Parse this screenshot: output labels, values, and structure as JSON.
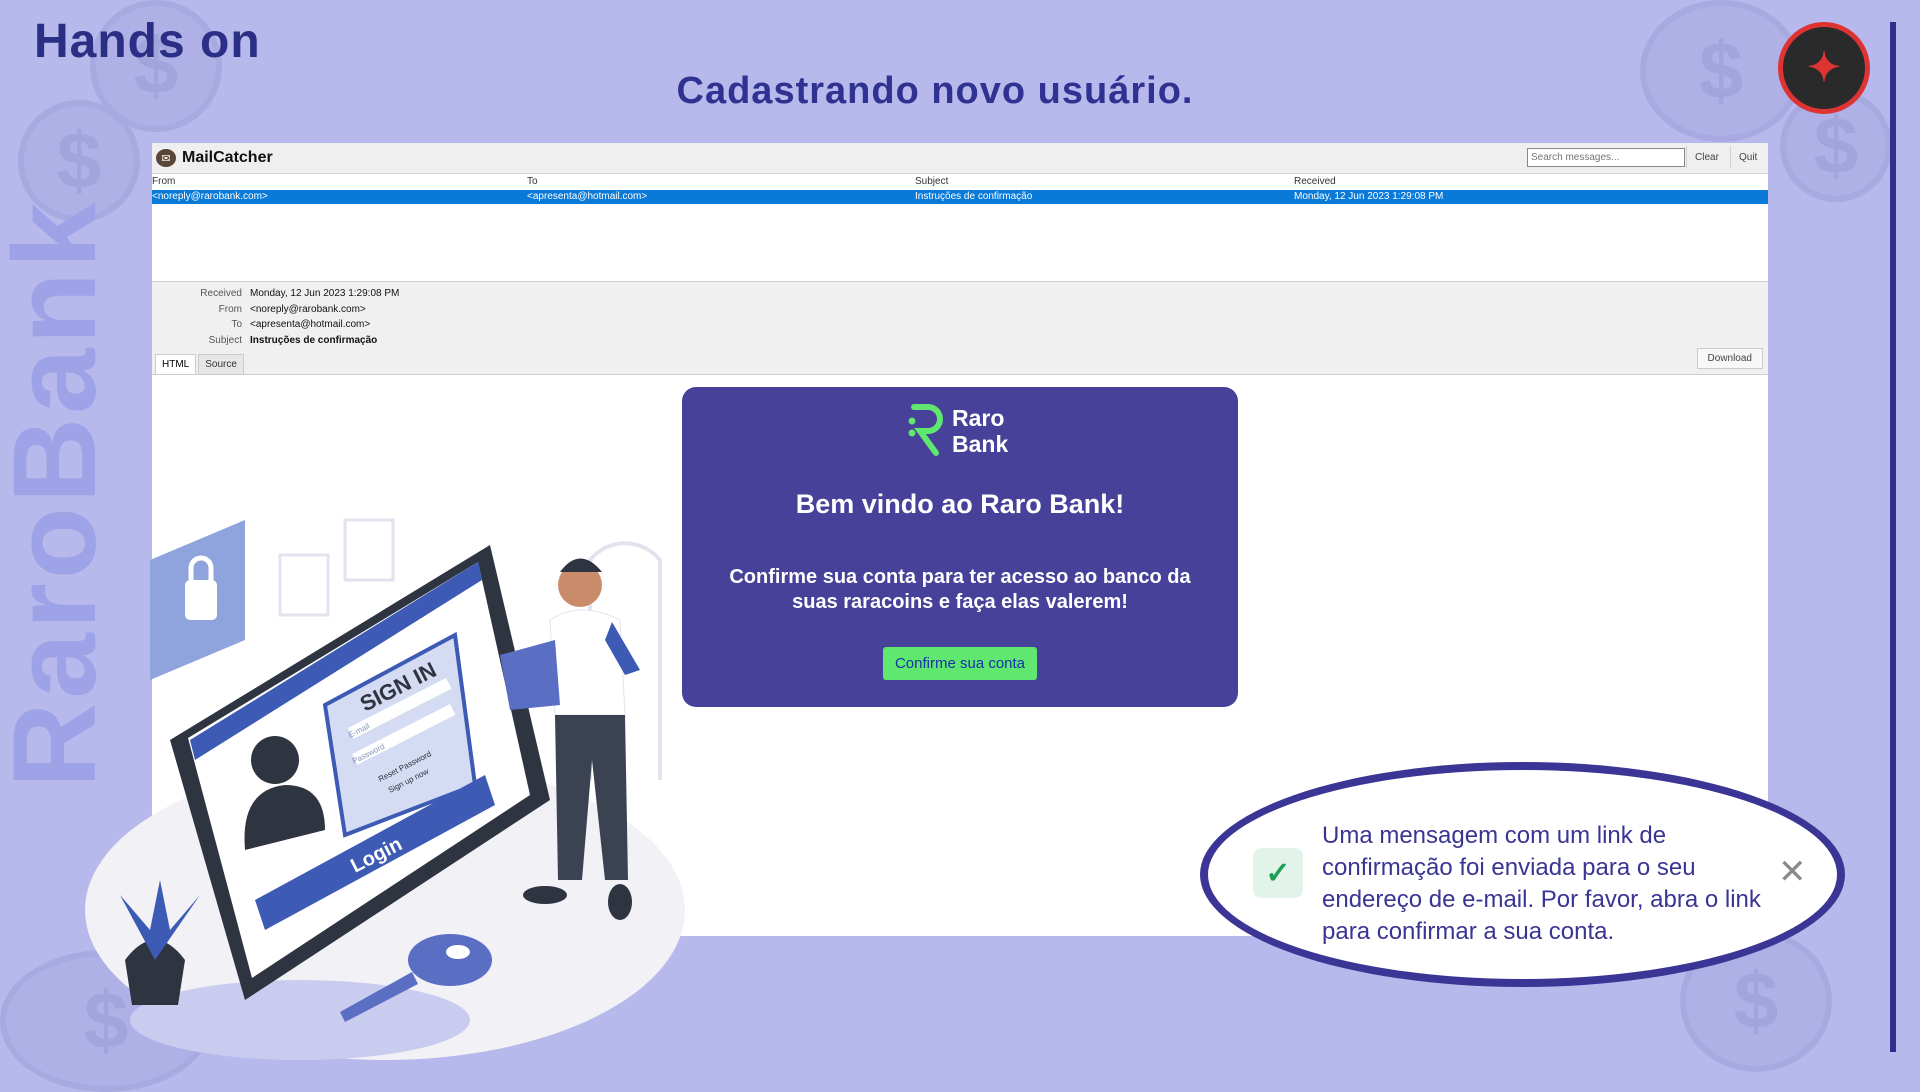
{
  "slide": {
    "title": "Hands on",
    "subtitle": "Cadastrando novo usuário.",
    "vertical_brand": "RaroBank",
    "coin_symbol": "$"
  },
  "mailcatcher": {
    "app_name": "MailCatcher",
    "search_placeholder": "Search messages...",
    "clear_label": "Clear",
    "quit_label": "Quit",
    "columns": [
      "From",
      "To",
      "Subject",
      "Received"
    ],
    "messages": [
      {
        "from": "<noreply@rarobank.com>",
        "to": "<apresenta@hotmail.com>",
        "subject": "Instruções de confirmação",
        "received": "Monday, 12 Jun 2023 1:29:08 PM"
      }
    ],
    "detail": {
      "received_label": "Received",
      "received": "Monday, 12 Jun 2023 1:29:08 PM",
      "from_label": "From",
      "from": "<noreply@rarobank.com>",
      "to_label": "To",
      "to": "<apresenta@hotmail.com>",
      "subject_label": "Subject",
      "subject": "Instruções de confirmação"
    },
    "tabs": [
      "HTML",
      "Source"
    ],
    "download_label": "Download"
  },
  "email": {
    "brand_line1": "Raro",
    "brand_line2": "Bank",
    "heading": "Bem vindo ao Raro Bank!",
    "body": "Confirme sua conta para ter acesso ao banco da suas raracoins e faça elas valerem!",
    "button_label": "Confirme sua conta"
  },
  "illustration": {
    "sign_in_text": "SIGN IN",
    "email_field": "E-mail",
    "password_field": "Password",
    "reset_password": "Reset Password",
    "sign_up": "Sign up now",
    "login_text": "Login"
  },
  "toast": {
    "message": "Uma mensagem com um link de confirmação foi enviada para o seu endereço de e-mail. Por favor, abra o link para confirmar a sua conta.",
    "close_glyph": "✕",
    "check_glyph": "✓"
  },
  "colors": {
    "background": "#b7b9ec",
    "title": "#2b2e85",
    "email_card": "#47419a",
    "confirm_button": "#5fe76f",
    "row_selected": "#0a7ad8",
    "toast_border": "#3b3595"
  }
}
